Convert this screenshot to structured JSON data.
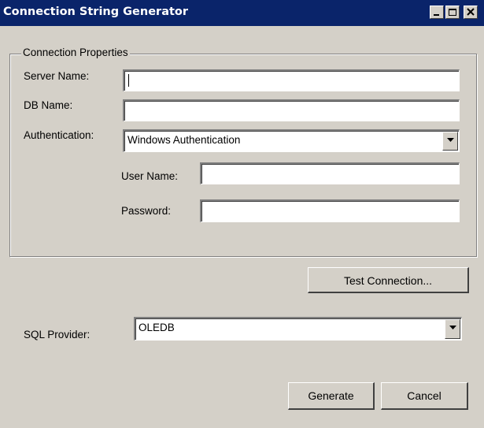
{
  "window": {
    "title": "Connection String Generator",
    "title_bar_color": "#0a246a",
    "face_color": "#d4d0c8",
    "controls": [
      "minimize-icon",
      "maximize-icon",
      "close-icon"
    ]
  },
  "connection_properties": {
    "legend": "Connection Properties",
    "server_name": {
      "label": "Server Name:",
      "value": ""
    },
    "db_name": {
      "label": "DB Name:",
      "value": ""
    },
    "authentication": {
      "label": "Authentication:",
      "selected": "Windows Authentication"
    },
    "user_name": {
      "label": "User Name:",
      "value": ""
    },
    "password": {
      "label": "Password:",
      "value": ""
    }
  },
  "test_connection_label": "Test Connection...",
  "sql_provider": {
    "label": "SQL Provider:",
    "selected": "OLEDB"
  },
  "footer": {
    "generate_label": "Generate",
    "cancel_label": "Cancel"
  }
}
